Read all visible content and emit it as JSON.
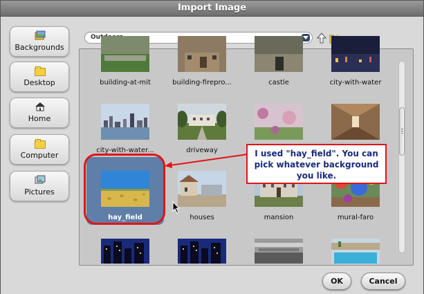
{
  "window": {
    "title": "Import Image"
  },
  "sidebar": {
    "items": [
      {
        "label": "Backgrounds",
        "icon": "backgrounds-icon"
      },
      {
        "label": "Desktop",
        "icon": "folder-icon"
      },
      {
        "label": "Home",
        "icon": "house-icon"
      },
      {
        "label": "Computer",
        "icon": "folder-icon"
      },
      {
        "label": "Pictures",
        "icon": "pictures-icon"
      }
    ]
  },
  "location": {
    "selected": "Outdoors"
  },
  "toolbar": {
    "up_icon": "up-arrow-icon",
    "new_folder_icon": "new-folder-icon"
  },
  "files": [
    {
      "name": "building-at-mit"
    },
    {
      "name": "building-firepro..."
    },
    {
      "name": "castle"
    },
    {
      "name": "city-with-water"
    },
    {
      "name": "city-with-water..."
    },
    {
      "name": "driveway"
    },
    {
      "name": "",
      "hidden": true
    },
    {
      "name": "",
      "hidden": true
    },
    {
      "name": "hay_field",
      "selected": true
    },
    {
      "name": "houses"
    },
    {
      "name": "mansion"
    },
    {
      "name": "mural-faro"
    }
  ],
  "annotation": {
    "text": "I used \"hay_field\". You can pick whatever background you like.",
    "color": "#e01414"
  },
  "buttons": {
    "ok": "OK",
    "cancel": "Cancel"
  },
  "colors": {
    "selection": "#5f7ea8",
    "callout_text": "#1a2a7a"
  }
}
